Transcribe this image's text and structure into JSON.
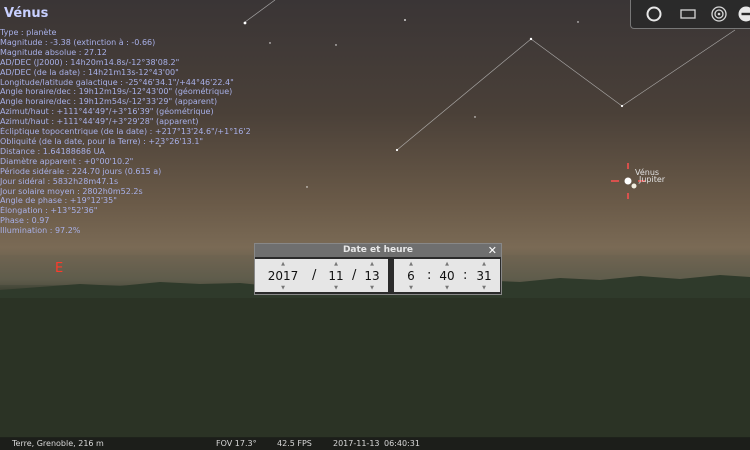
{
  "object": {
    "name": "Vénus",
    "lines": [
      "Type : planète",
      "Magnitude : -3.38 (extinction à : -0.66)",
      "Magnitude absolue : 27.12",
      "AD/DEC (J2000) : 14h20m14.8s/-12°38'08.2\"",
      "AD/DEC (de la date) : 14h21m13s-12°43'00\"",
      "Longitude/latitude galactique : -25°46'34.1\"/+44°46'22.4\"",
      "Angle horaire/dec : 19h12m19s/-12°43'00\" (géométrique)",
      "Angle horaire/dec : 19h12m54s/-12°33'29\" (apparent)",
      "Azimut/haut : +111°44'49\"/+3°16'39\" (géométrique)",
      "Azimut/haut : +111°44'49\"/+3°29'28\" (apparent)",
      "Écliptique topocentrique (de la date) : +217°13'24.6\"/+1°16'29.4\"",
      "Obliquité (de la date, pour la Terre) : +23°26'13.1\"",
      "Distance : 1.64188686 UA",
      "Diamètre apparent : +0°00'10.2\"",
      "Période sidérale : 224.70 jours (0.615 a)",
      "Jour sidéral : 5832h28m47.1s",
      "Jour solaire moyen : 2802h0m52.2s",
      "Angle de phase : +19°12'35\"",
      "Élongation : +13°52'36\"",
      "Phase : 0.97",
      "Illumination : 97.2%"
    ]
  },
  "sky": {
    "labels": {
      "venus": "Vénus",
      "jupiter": "Jupiter",
      "cardinal": "E"
    }
  },
  "toolbar": {
    "icons": [
      "sphere-icon",
      "rectangle-icon",
      "target-icon",
      "minus-circle-icon"
    ]
  },
  "dialog": {
    "title": "Date et heure",
    "close": "✕",
    "year": "2017",
    "month": "11",
    "day": "13",
    "hour": "6",
    "minute": "40",
    "second": "31",
    "date_sep": "/",
    "time_sep": ":",
    "up_arrow": "▲",
    "down_arrow": "▼"
  },
  "status": {
    "location": "Terre, Grenoble, 216 m",
    "fov": "FOV 17.3°",
    "fps": "42.5 FPS",
    "date": "2017-11-13",
    "time": "06:40:31"
  }
}
